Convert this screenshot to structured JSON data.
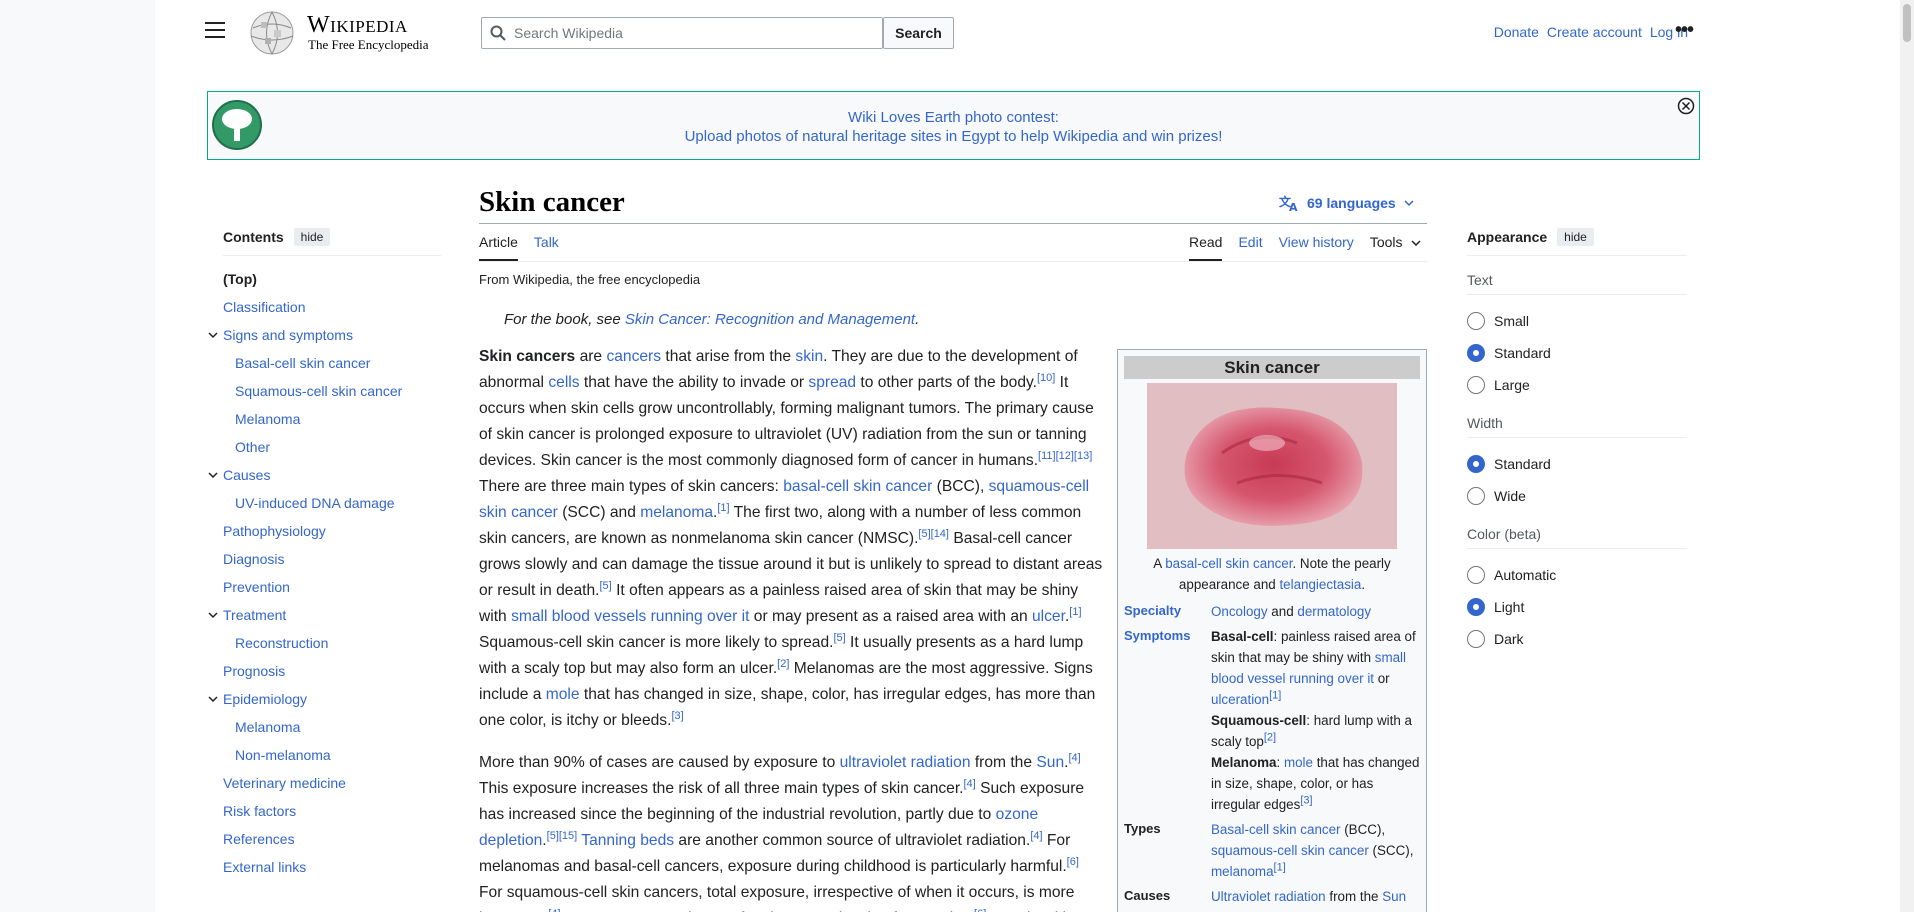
{
  "header": {
    "wordmark_title": "Wikipedia",
    "wordmark_tagline": "The Free Encyclopedia",
    "search_placeholder": "Search Wikipedia",
    "search_button": "Search",
    "links": [
      "Donate",
      "Create account",
      "Log in"
    ]
  },
  "banner": {
    "line1": "Wiki Loves Earth photo contest:",
    "line2": "Upload photos of natural heritage sites in Egypt to help Wikipedia and win prizes!"
  },
  "toc": {
    "title": "Contents",
    "hide": "hide",
    "items": [
      {
        "label": "(Top)",
        "level": 1,
        "chevron": false
      },
      {
        "label": "Classification",
        "level": 1,
        "chevron": false
      },
      {
        "label": "Signs and symptoms",
        "level": 1,
        "chevron": true
      },
      {
        "label": "Basal-cell skin cancer",
        "level": 2,
        "chevron": false
      },
      {
        "label": "Squamous-cell skin cancer",
        "level": 2,
        "chevron": false
      },
      {
        "label": "Melanoma",
        "level": 2,
        "chevron": false
      },
      {
        "label": "Other",
        "level": 2,
        "chevron": false
      },
      {
        "label": "Causes",
        "level": 1,
        "chevron": true
      },
      {
        "label": "UV-induced DNA damage",
        "level": 2,
        "chevron": false
      },
      {
        "label": "Pathophysiology",
        "level": 1,
        "chevron": false
      },
      {
        "label": "Diagnosis",
        "level": 1,
        "chevron": false
      },
      {
        "label": "Prevention",
        "level": 1,
        "chevron": false
      },
      {
        "label": "Treatment",
        "level": 1,
        "chevron": true
      },
      {
        "label": "Reconstruction",
        "level": 2,
        "chevron": false
      },
      {
        "label": "Prognosis",
        "level": 1,
        "chevron": false
      },
      {
        "label": "Epidemiology",
        "level": 1,
        "chevron": true
      },
      {
        "label": "Melanoma",
        "level": 2,
        "chevron": false
      },
      {
        "label": "Non-melanoma",
        "level": 2,
        "chevron": false
      },
      {
        "label": "Veterinary medicine",
        "level": 1,
        "chevron": false
      },
      {
        "label": "Risk factors",
        "level": 1,
        "chevron": false
      },
      {
        "label": "References",
        "level": 1,
        "chevron": false
      },
      {
        "label": "External links",
        "level": 1,
        "chevron": false
      }
    ]
  },
  "article": {
    "title": "Skin cancer",
    "languages": "69 languages",
    "tabs_left": [
      "Article",
      "Talk"
    ],
    "tabs_right": [
      "Read",
      "Edit",
      "View history",
      "Tools"
    ],
    "from": "From Wikipedia, the free encyclopedia",
    "hatnote_prefix": "For the book, see ",
    "hatnote_link": "Skin Cancer: Recognition and Management",
    "hatnote_suffix": "."
  },
  "infobox": {
    "title": "Skin cancer",
    "caption_pre": "A ",
    "caption_link1": "basal-cell skin cancer",
    "caption_mid": ". Note the pearly appearance and ",
    "caption_link2": "telangiectasia",
    "caption_end": ".",
    "specialty_label": "Specialty",
    "specialty_link1": "Oncology",
    "specialty_and": " and ",
    "specialty_link2": "dermatology",
    "symptoms_label": "Symptoms",
    "types_label": "Types",
    "causes_label": "Causes",
    "causes_value_link1": "Ultraviolet radiation",
    "causes_value_mid": " from the ",
    "causes_value_link2": "Sun"
  },
  "appearance": {
    "title": "Appearance",
    "hide": "hide",
    "groups": [
      {
        "label": "Text",
        "options": [
          "Small",
          "Standard",
          "Large"
        ],
        "selected": 1
      },
      {
        "label": "Width",
        "options": [
          "Standard",
          "Wide"
        ],
        "selected": 0
      },
      {
        "label": "Color (beta)",
        "options": [
          "Automatic",
          "Light",
          "Dark"
        ],
        "selected": 1
      }
    ]
  },
  "colors": {
    "link": "#3366cc",
    "banner_border": "#00af89",
    "radio_selected": "#3366cc"
  }
}
